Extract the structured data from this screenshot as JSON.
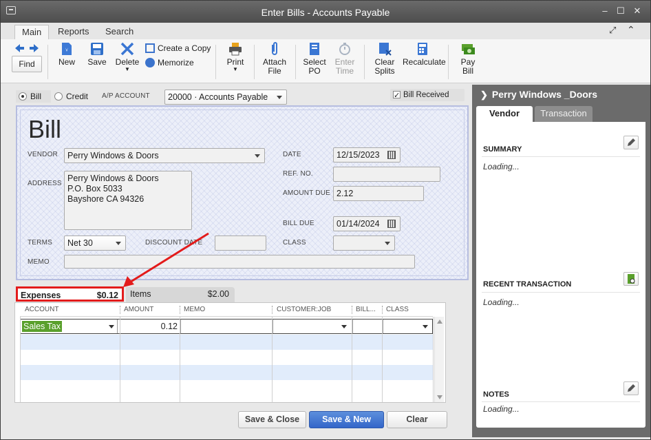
{
  "window": {
    "title": "Enter Bills - Accounts Payable"
  },
  "tabs": [
    "Main",
    "Reports",
    "Search"
  ],
  "toolbar": {
    "find": "Find",
    "new": "New",
    "save": "Save",
    "delete": "Delete",
    "create_copy": "Create a Copy",
    "memorize": "Memorize",
    "print": "Print",
    "attach1": "Attach",
    "attach2": "File",
    "select1": "Select",
    "select2": "PO",
    "enter1": "Enter",
    "enter2": "Time",
    "clear1": "Clear",
    "clear2": "Splits",
    "recalc": "Recalculate",
    "pay1": "Pay",
    "pay2": "Bill"
  },
  "form": {
    "bill_radio": "Bill",
    "credit_radio": "Credit",
    "ap_account_label": "A/P ACCOUNT",
    "ap_account": "20000 · Accounts Payable",
    "bill_received": "Bill Received",
    "title": "Bill",
    "vendor_label": "VENDOR",
    "vendor": "Perry Windows & Doors",
    "address_label": "ADDRESS",
    "address_lines": [
      "Perry Windows & Doors",
      "P.O. Box 5033",
      "Bayshore CA 94326"
    ],
    "date_label": "DATE",
    "date": "12/15/2023",
    "ref_label": "REF. NO.",
    "amount_due_label": "AMOUNT DUE",
    "amount_due": "2.12",
    "bill_due_label": "BILL DUE",
    "bill_due": "01/14/2024",
    "terms_label": "TERMS",
    "terms": "Net 30",
    "discount_label": "DISCOUNT DATE",
    "class_label": "CLASS",
    "memo_label": "MEMO"
  },
  "detail_tabs": {
    "expenses_label": "Expenses",
    "expenses_amount": "$0.12",
    "items_label": "Items",
    "items_amount": "$2.00"
  },
  "grid": {
    "columns": [
      "ACCOUNT",
      "AMOUNT",
      "MEMO",
      "CUSTOMER:JOB",
      "BILL...",
      "CLASS"
    ],
    "rows": [
      {
        "account": "Sales Tax",
        "amount": "0.12"
      }
    ]
  },
  "buttons": {
    "save_close": "Save & Close",
    "save_new": "Save & New",
    "clear": "Clear"
  },
  "right_panel": {
    "vendor_name": "Perry Windows _Doors",
    "tab_vendor": "Vendor",
    "tab_transaction": "Transaction",
    "summary": "SUMMARY",
    "recent": "RECENT TRANSACTION",
    "notes": "NOTES",
    "loading": "Loading..."
  },
  "colors": {
    "annotation_red": "#e31b1b",
    "highlight_green": "#5aa02c",
    "primary_blue": "#3d73d1"
  }
}
